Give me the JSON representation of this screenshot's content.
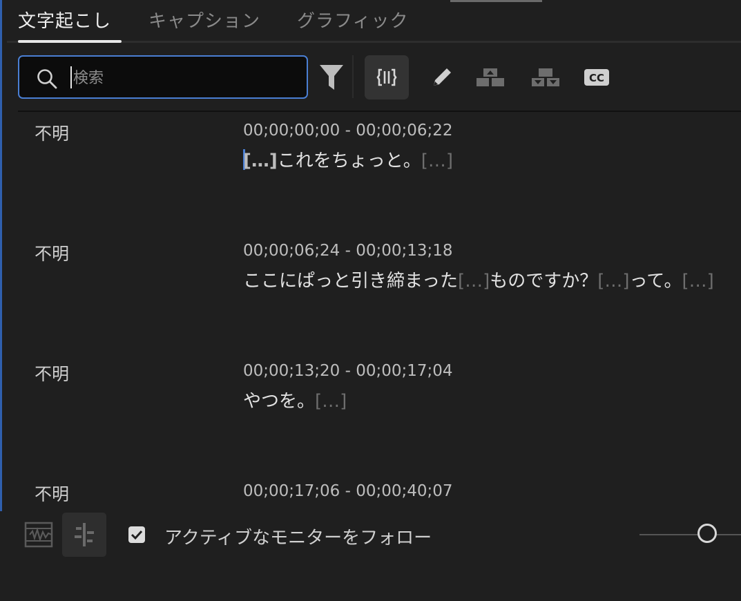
{
  "tabs": [
    {
      "label": "文字起こし",
      "active": true
    },
    {
      "label": "キャプション",
      "active": false
    },
    {
      "label": "グラフィック",
      "active": false
    }
  ],
  "search": {
    "placeholder": "検索",
    "value": ""
  },
  "toolbar": {
    "icons": [
      "filter-icon",
      "merge-segments-icon",
      "edit-icon",
      "split-segment-up-icon",
      "split-segment-down-icon",
      "cc-icon"
    ],
    "cc_label": "CC"
  },
  "segments": [
    {
      "speaker": "不明",
      "timecode": "00;00;00;00 - 00;00;06;22",
      "lead_pause": "[…]",
      "text": "これをちょっと。",
      "pause1": "[…]"
    },
    {
      "speaker": "不明",
      "timecode": "00;00;06;24 - 00;00;13;18",
      "text1": "ここにぱっと引き締まった",
      "pause1": "[…]",
      "text2": "ものですか？",
      "pause2": "[…]",
      "text3": "って。",
      "pause3": "[…]"
    },
    {
      "speaker": "不明",
      "timecode": "00;00;13;20 - 00;00;17;04",
      "text": "やつを。",
      "pause1": "[…]"
    },
    {
      "speaker": "不明",
      "timecode": "00;00;17;06 - 00;00;40;07"
    }
  ],
  "bottom": {
    "follow_label": "アクティブなモニターをフォロー",
    "follow_checked": true,
    "icons": [
      "audio-waveform-icon",
      "transcript-align-icon"
    ]
  },
  "colors": {
    "accent": "#4a7fd4",
    "background": "#1f1f1f",
    "pause_text": "#6e6e6e"
  }
}
